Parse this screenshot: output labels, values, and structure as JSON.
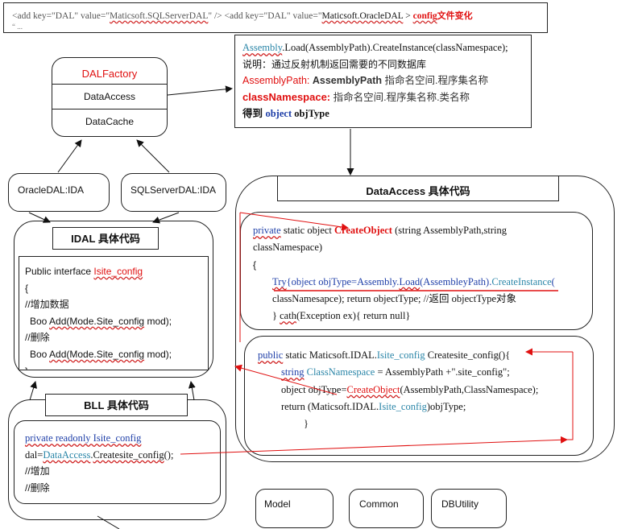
{
  "config_bar": {
    "part1": "<add key=\"DAL\" value=\"",
    "sql_value": "Maticsoft.SQLServerDAL",
    "part2": "\" /> <add key=\"DAL\" value=\"",
    "ora_value": "Maticsoft.OracleDAL",
    "part3": " > ",
    "config_word": "config",
    "change_text": "文件变化",
    "dots": "“  ..."
  },
  "dalfactory": {
    "title": "DALFactory",
    "row1": "DataAccess",
    "row2": "DataCache"
  },
  "explain": {
    "line1_assembly": "Assembly",
    "line1_rest": ".Load(AssemblyPath).CreateInstance(classNamespace);",
    "line2": "说明：通过反射机制返回需要的不同数据库",
    "line3_label": "AssemblyPath: ",
    "line3_bold": "AssemblyPath",
    "line3_rest": " 指命名空间.程序集名称",
    "line4_label": "classNamespace:",
    "line4_rest": "  指命名空间.程序集名称.类名称",
    "line5_a": "得到 ",
    "line5_b": "object",
    "line5_c": " objType"
  },
  "oracle_box": "OracleDAL:IDA",
  "sql_box": "SQLServerDAL:IDA",
  "idal": {
    "title": "IDAL 具体代码",
    "l1_a": "Public interface ",
    "l1_b": "Isite_config",
    "l2": "{",
    "l3": "//增加数据",
    "l4_a": "Boo ",
    "l4_b": "Add(Mode.Site_config",
    "l4_c": " mod);",
    "l5": "//删除",
    "l6_a": "Boo ",
    "l6_b": "Add(Mode.Site_config",
    "l6_c": " mod);",
    "l7": "}"
  },
  "bll": {
    "title": "BLL 具体代码",
    "l1": "private readonly Isite_config",
    "l2_a": "dal=",
    "l2_b": "DataAccess",
    "l2_c": ".",
    "l2_d": "Createsite_config",
    "l2_e": "();",
    "l3": "//增加",
    "l4": "//删除"
  },
  "dataaccess": {
    "title": "DataAccess  具体代码",
    "c1_l1_a": "private",
    "c1_l1_b": " static object ",
    "c1_l1_c": "CreateObject",
    "c1_l1_d": " (string AssemblyPath,string",
    "c1_l2": "classNamespace)",
    "c1_l3": "{",
    "c1_l4_a": "Try",
    "c1_l4_b": "{object objType=Assembly.",
    "c1_l4_c": "Load",
    "c1_l4_d": "(AssembleyPath).",
    "c1_l4_e": "CreateInstance",
    "c1_l4_f": "(",
    "c1_l5": "classNamesapce); return objectType; //返回  objectType对象",
    "c1_l6_a": "} ",
    "c1_l6_b": "cath",
    "c1_l6_c": "(Exception ex){ return null}",
    "c2_l1_a": "public",
    "c2_l1_b": " static Maticsoft.IDAL.",
    "c2_l1_c": "Isite_config",
    "c2_l1_d": " Createsite_config(){",
    "c2_l2_a": "string",
    "c2_l2_b": " ClassNamespace",
    "c2_l2_c": " = AssemblyPath +\".site_config\";",
    "c2_l3_a": "object objType=",
    "c2_l3_b": "CreateObject",
    "c2_l3_c": "(AssemblyPath,ClassNamespace);",
    "c2_l4_a": "return (Maticsoft.IDAL.",
    "c2_l4_b": "Isite_config",
    "c2_l4_c": ")objType;",
    "c2_l5": "}"
  },
  "bottom_boxes": [
    "Model",
    "Common",
    "DBUtility"
  ]
}
